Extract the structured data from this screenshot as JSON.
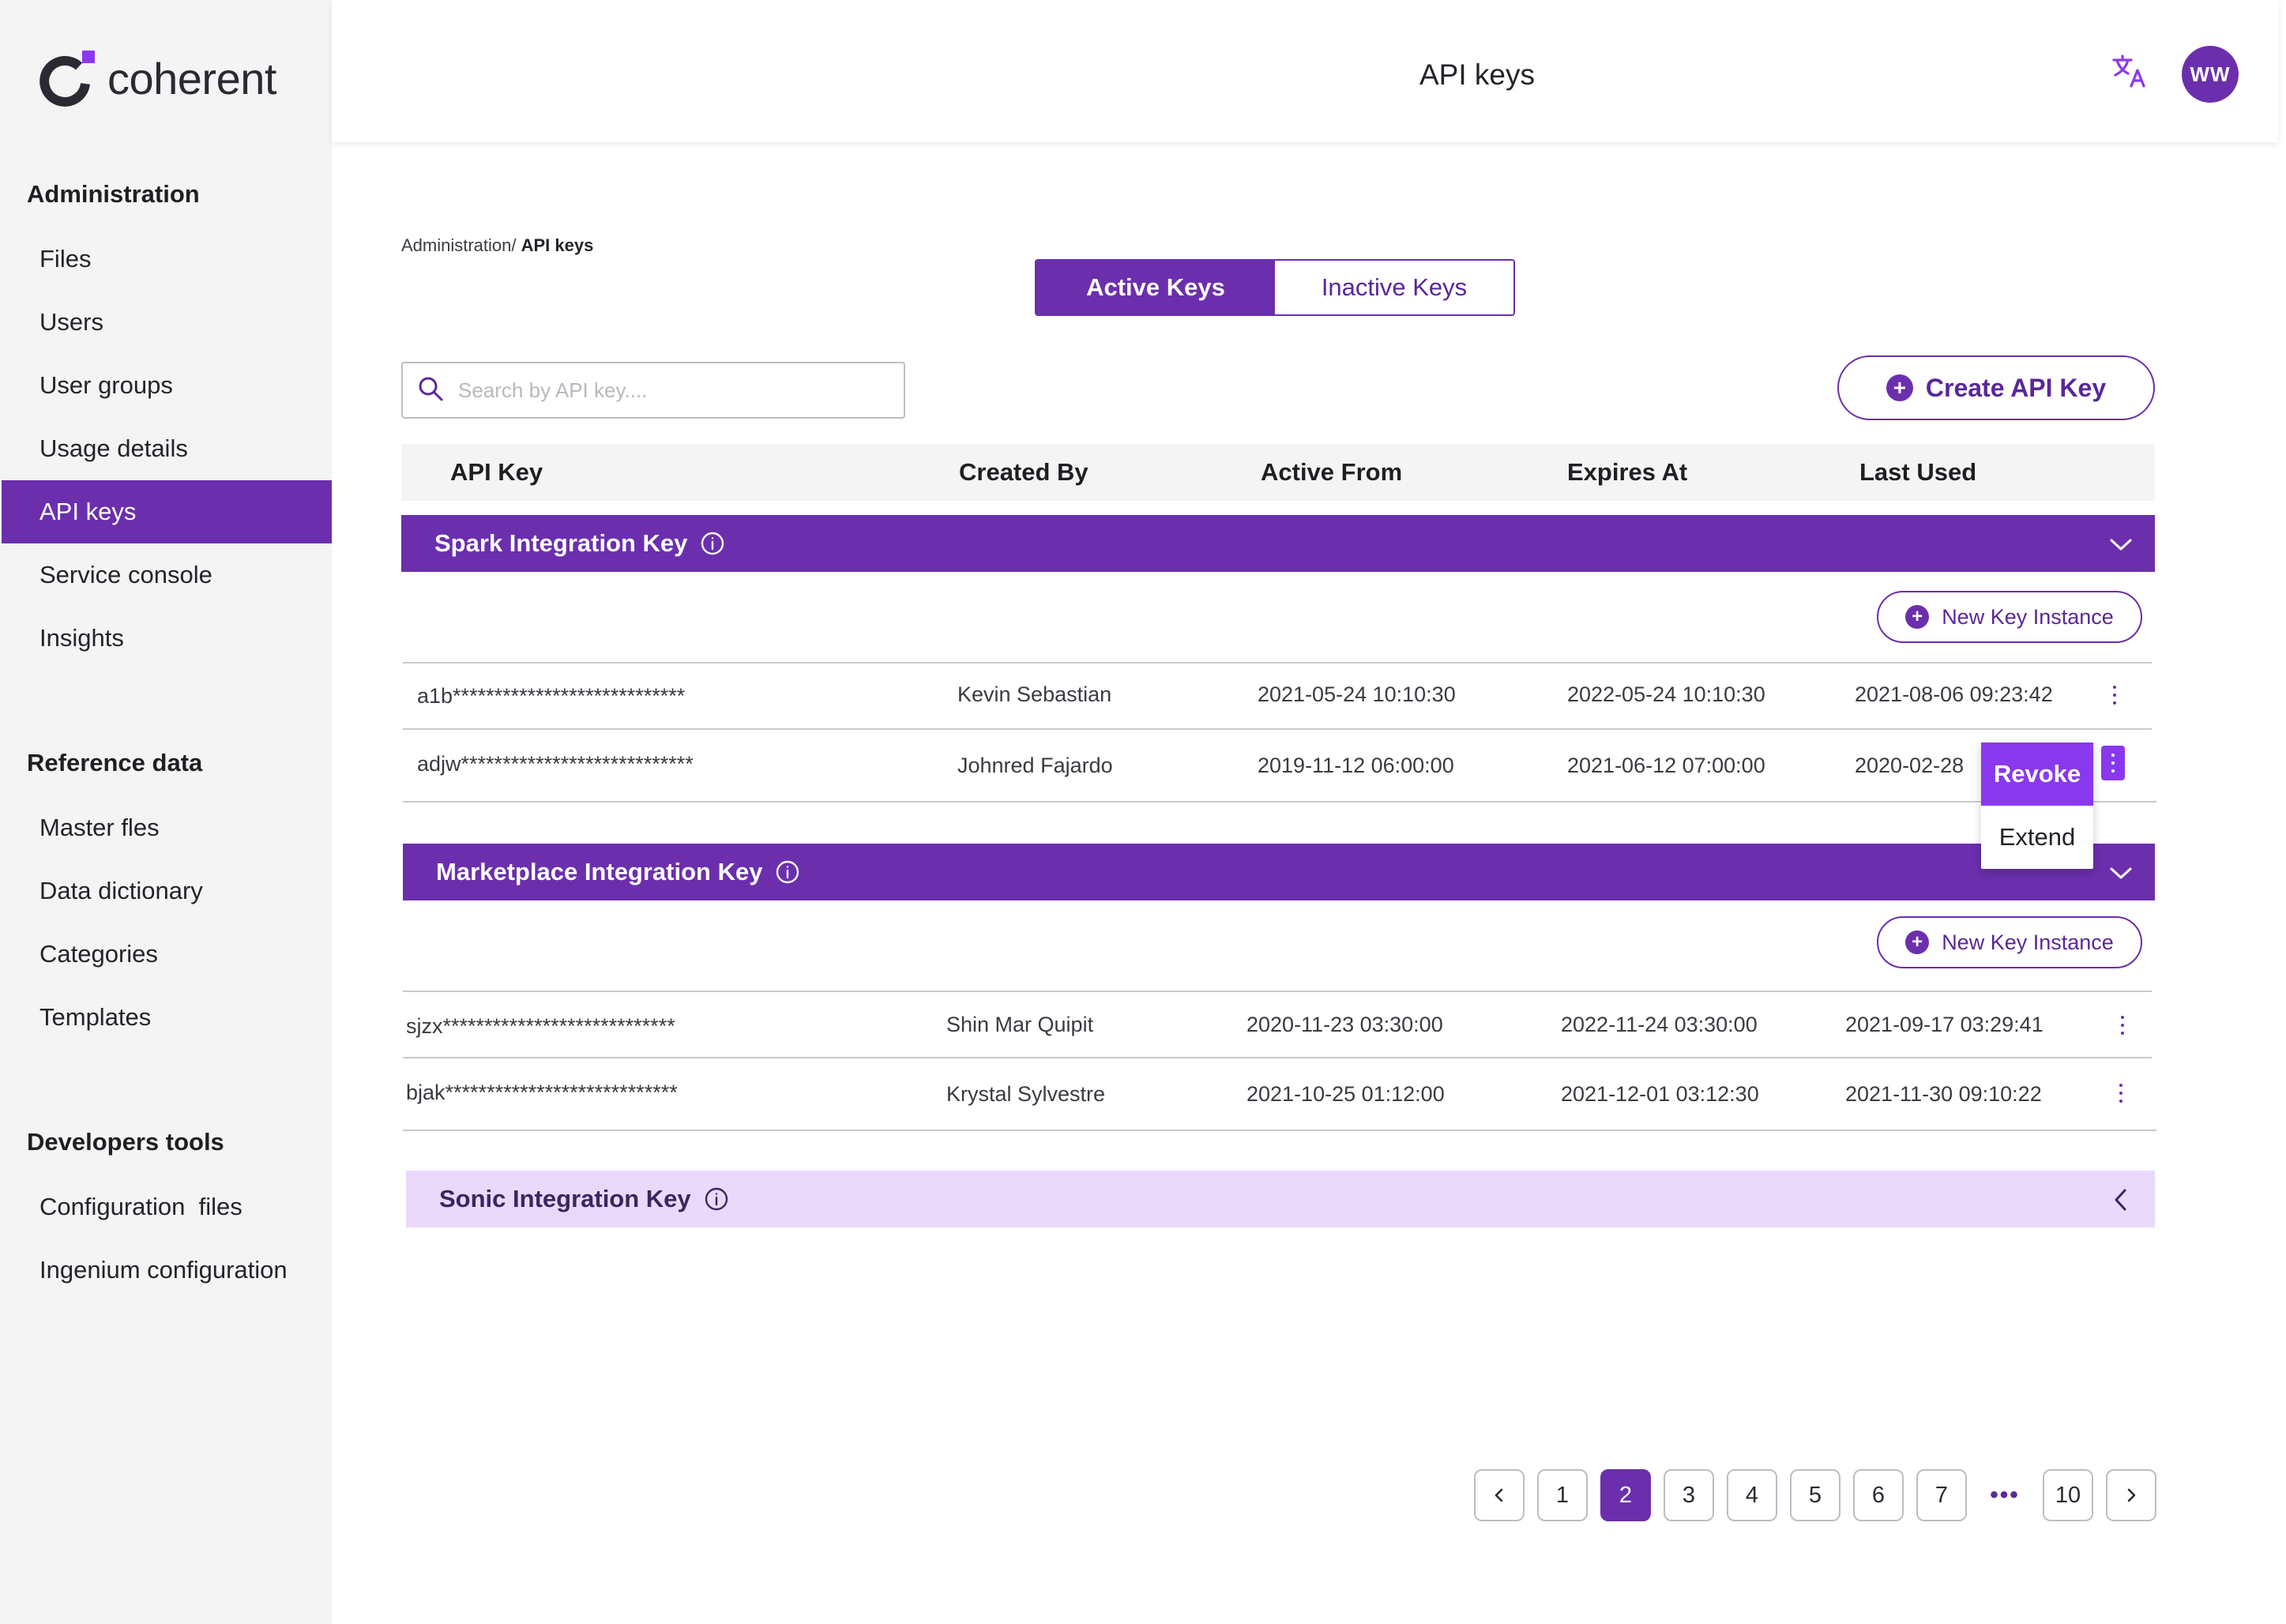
{
  "brand": {
    "name": "coherent",
    "accent": "#6b2fad"
  },
  "header": {
    "title": "API keys",
    "avatar_initials": "WW"
  },
  "sidebar": {
    "sections": [
      {
        "title": "Administration",
        "items": [
          "Files",
          "Users",
          "User groups",
          "Usage details",
          "API keys",
          "Service console",
          "Insights"
        ]
      },
      {
        "title": "Reference data",
        "items": [
          "Master fles",
          "Data dictionary",
          "Categories",
          "Templates"
        ]
      },
      {
        "title": "Developers tools",
        "items": [
          "Configuration  files",
          "Ingenium configuration"
        ]
      }
    ],
    "active_item": "API keys"
  },
  "breadcrumb": {
    "parent": "Administration",
    "separator": "/ ",
    "current": "API keys"
  },
  "tabs": {
    "active": "Active Keys",
    "inactive": "Inactive Keys"
  },
  "search": {
    "placeholder": "Search by API key...."
  },
  "create_button": "Create API Key",
  "table": {
    "columns": [
      "API Key",
      "Created By",
      "Active From",
      "Expires At",
      "Last Used"
    ],
    "new_key_label": "New Key Instance",
    "groups": [
      {
        "name": "Spark Integration Key",
        "rows": [
          {
            "key": "a1b****************************",
            "created_by": "Kevin Sebastian",
            "active_from": "2021-05-24 10:10:30",
            "expires_at": "2022-05-24 10:10:30",
            "last_used": "2021-08-06 09:23:42"
          },
          {
            "key": "adjw****************************",
            "created_by": "Johnred Fajardo",
            "active_from": "2019-11-12 06:00:00",
            "expires_at": "2021-06-12 07:00:00",
            "last_used": "2020-02-28"
          }
        ]
      },
      {
        "name": "Marketplace Integration Key",
        "rows": [
          {
            "key": "sjzx****************************",
            "created_by": "Shin Mar Quipit",
            "active_from": "2020-11-23 03:30:00",
            "expires_at": "2022-11-24 03:30:00",
            "last_used": "2021-09-17 03:29:41"
          },
          {
            "key": "bjak****************************",
            "created_by": "Krystal Sylvestre",
            "active_from": "2021-10-25 01:12:00",
            "expires_at": "2021-12-01 03:12:30",
            "last_used": "2021-11-30 09:10:22"
          }
        ]
      },
      {
        "name": "Sonic Integration Key",
        "rows": []
      }
    ]
  },
  "row_menu": {
    "revoke": "Revoke",
    "extend": "Extend"
  },
  "pagination": {
    "pages": [
      "1",
      "2",
      "3",
      "4",
      "5",
      "6",
      "7"
    ],
    "ellipsis": "•••",
    "last": "10",
    "current": "2"
  }
}
